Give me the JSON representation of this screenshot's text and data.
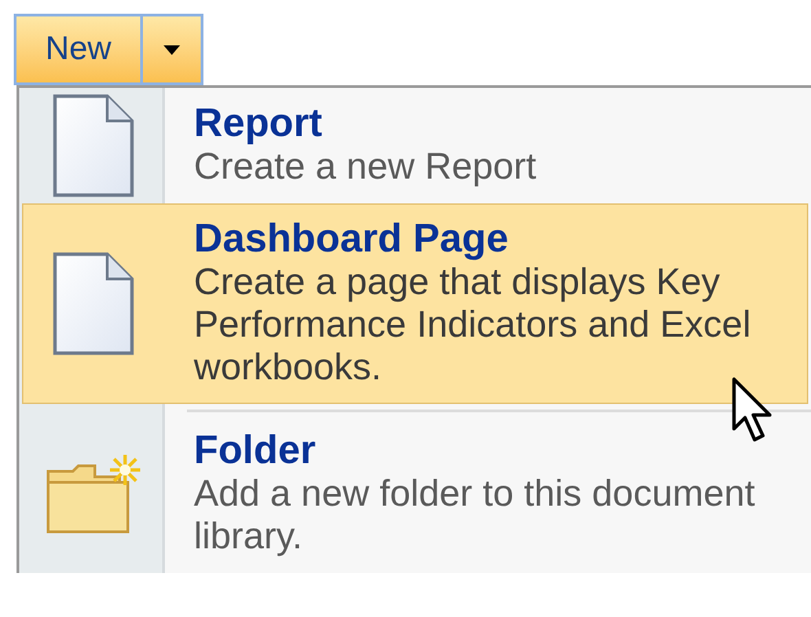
{
  "toolbar": {
    "new_button": {
      "label": "New"
    },
    "dropdown_open": true
  },
  "menu": {
    "items": [
      {
        "kind": "document",
        "title": "Report",
        "description": "Create a new Report",
        "selected": false
      },
      {
        "kind": "document",
        "title": "Dashboard Page",
        "description": "Create a page that displays Key Performance Indicators and Excel workbooks.",
        "selected": true
      },
      {
        "kind": "folder",
        "title": "Folder",
        "description": "Add a new folder to this document library.",
        "selected": false
      }
    ]
  }
}
